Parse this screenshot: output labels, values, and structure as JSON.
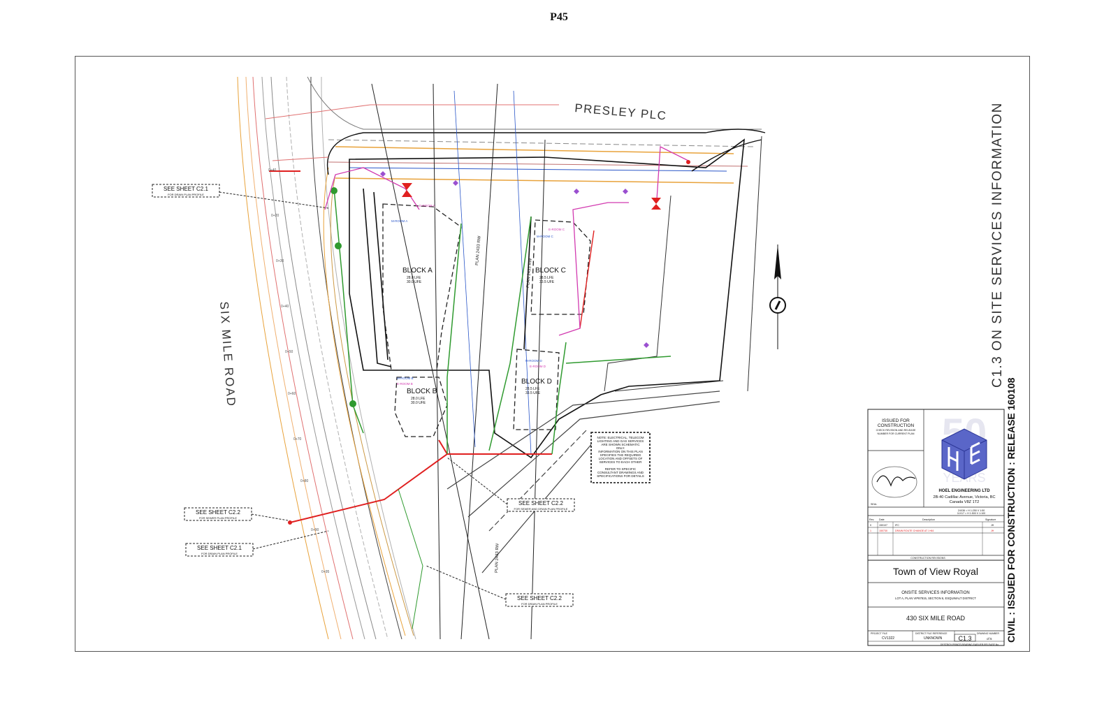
{
  "page_number": "P45",
  "streets": {
    "north": "PRESLEY PLC",
    "west": "SIX MILE ROAD"
  },
  "blocks": [
    {
      "name": "BLOCK A",
      "lfe1": "28.0 LFE",
      "lfe2": "30.0 UFE"
    },
    {
      "name": "BLOCK B",
      "lfe1": "28.0 LFE",
      "lfe2": "30.0 UFE"
    },
    {
      "name": "BLOCK C",
      "lfe1": "28.5 LFE",
      "lfe2": "33.5 UFE"
    },
    {
      "name": "BLOCK D",
      "lfe1": "28.5 LFE",
      "lfe2": "33.5 UFE"
    }
  ],
  "rooms": [
    "M-ROOM A",
    "E-ROOM A",
    "M-ROOM B",
    "E-ROOM B",
    "M-ROOM C",
    "E-ROOM C",
    "M-ROOM D",
    "E-ROOM D"
  ],
  "plan_labels": [
    "PLAN 2433 RW",
    "PLAN 2433 RW",
    "PLAN 2433 RW"
  ],
  "sheet_refs": [
    {
      "title": "SEE SHEET C2.1",
      "sub": "FOR DRAIN PLAN PROFILE"
    },
    {
      "title": "SEE SHEET C2.2",
      "sub": "FOR SEWER PLAN PROFILE"
    },
    {
      "title": "SEE SHEET C2.1",
      "sub": "FOR DRAIN PLAN PROFILE"
    },
    {
      "title": "SEE SHEET C2.2",
      "sub": "FOR SEWER AND DRAIN PLAN PROFILE"
    },
    {
      "title": "SEE SHEET C2.2",
      "sub": "FOR DRAIN PLAN PROFILE"
    }
  ],
  "note_lines": [
    "NOTE: ELECTRICAL, TELECOM",
    "LIGHTING AND GAS SERVICES",
    "ARE SHOWN SCHEMATIC",
    "ONLY.",
    "INFORMATION ON THIS PLAN",
    "SPECIFIES THE REQUIRED",
    "LOCATION AND OFFSETS OF",
    "SERVICES TO EACH OTHER",
    "",
    "REFER TO SPECIFIC",
    "CONSULTANT DRAWINGS AND",
    "SPECIFICATIONS FOR DETAILS"
  ],
  "side_title": "C1.3 ON SITE SERVICES INFORMATION",
  "release_text": "CIVIL : ISSUED FOR CONSTRUCTION : RELEASE 160108",
  "title_block": {
    "issued_line1": "ISSUED FOR",
    "issued_line2": "CONSTRUCTION",
    "issued_note1": "CHECK REVISION AND RELEASE",
    "issued_note2": "NUMBER FOR CURRENT PLAN",
    "watermark_years": "YEARS",
    "watermark_number": "50",
    "company": "HOEL ENGINEERING LTD",
    "address1": "2B-40 Cadillac Avenue, Victoria, BC",
    "address2": "Canada V8Z 1T2",
    "seal_label": "SEAL",
    "scale_text": "24X36 = H 1:250  V 1:50",
    "scale_text2": "11X17 = H 1:500  V 1:100",
    "col_rev": "Rev.",
    "col_date": "Date",
    "col_desc": "Description",
    "col_sig": "Signature",
    "revisions": [
      {
        "rev": "0",
        "date": "150107",
        "desc": "IFC",
        "sig": "JH"
      },
      {
        "rev": "1",
        "date": "150730",
        "desc": "DRAIN ROUTE CHANGE AT 1+84",
        "sig": "JH"
      }
    ],
    "revisions_label": "CONSTRUCTION REVISIONS",
    "client": "Town of View Royal",
    "drawing_title": "ONSITE SERVICES INFORMATION",
    "legal": "LOT A, PLAN VIP87815, SECTION 6, ESQUIMALT DISTRICT",
    "address": "430 SIX MILE ROAD",
    "project_label": "PROJECT FILE",
    "project_file": "CV1322",
    "district_label": "DISTRICT FILE REFERENCE",
    "district_file": "UNKNOWN",
    "drawing_label": "DRAWING NUMBER",
    "drawing_number": "C1.3",
    "drawing_of": "of 5",
    "footer": "DESTROY PRINTS BEARING EARLIER RELEASE No."
  },
  "colors": {
    "sanitary": "#e02020",
    "storm": "#2f9a2f",
    "water": "#2a56c8",
    "gas": "#e8a23a",
    "power": "#d23ab0",
    "boundary": "#111111"
  }
}
